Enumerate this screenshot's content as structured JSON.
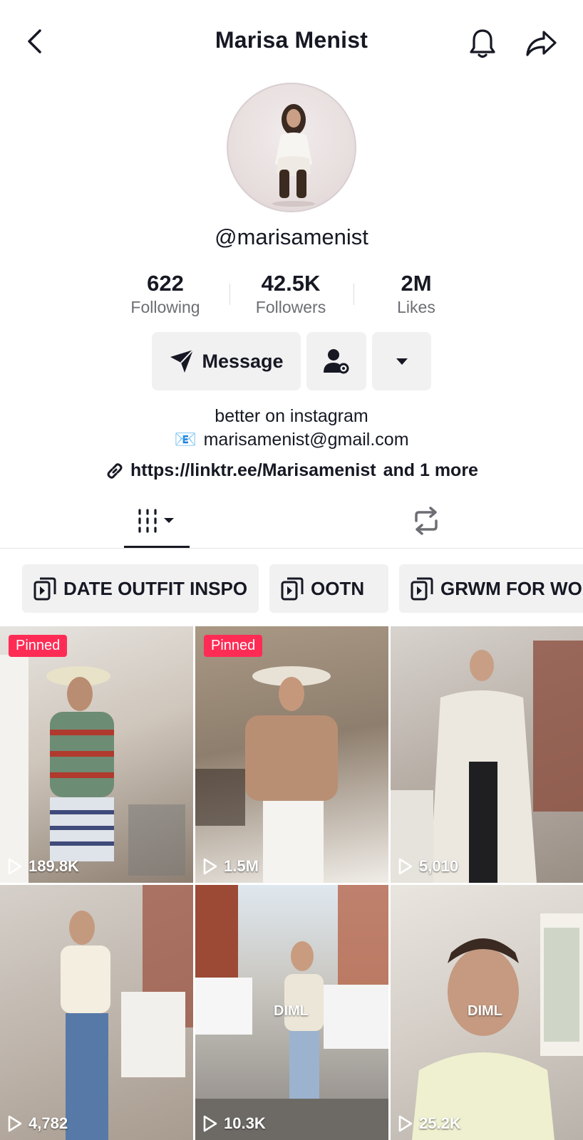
{
  "header": {
    "title": "Marisa Menist",
    "back_icon": "chevron-left-icon",
    "bell_icon": "bell-icon",
    "share_icon": "share-arrow-icon"
  },
  "profile": {
    "handle": "@marisamenist",
    "stats": [
      {
        "value": "622",
        "label": "Following"
      },
      {
        "value": "42.5K",
        "label": "Followers"
      },
      {
        "value": "2M",
        "label": "Likes"
      }
    ],
    "message_label": "Message",
    "bio_line1": "better on instagram",
    "email_emoji": "📧",
    "bio_line2": "marisamenist@gmail.com",
    "link": "https://linktr.ee/Marisamenist",
    "link_more": "and 1 more"
  },
  "playlists": [
    "DATE OUTFIT INSPO",
    "OOTN",
    "GRWM FOR WO"
  ],
  "videos": [
    {
      "pinned": "Pinned",
      "views": "189.8K",
      "overlay": ""
    },
    {
      "pinned": "Pinned",
      "views": "1.5M",
      "overlay": ""
    },
    {
      "pinned": "",
      "views": "5,010",
      "overlay": ""
    },
    {
      "pinned": "",
      "views": "4,782",
      "overlay": ""
    },
    {
      "pinned": "",
      "views": "10.3K",
      "overlay": "DIML"
    },
    {
      "pinned": "",
      "views": "25.2K",
      "overlay": "DIML"
    }
  ],
  "colors": {
    "accent": "#fe2c55",
    "text": "#161823",
    "muted": "#6d6e74",
    "button_bg": "#f1f1f2"
  }
}
